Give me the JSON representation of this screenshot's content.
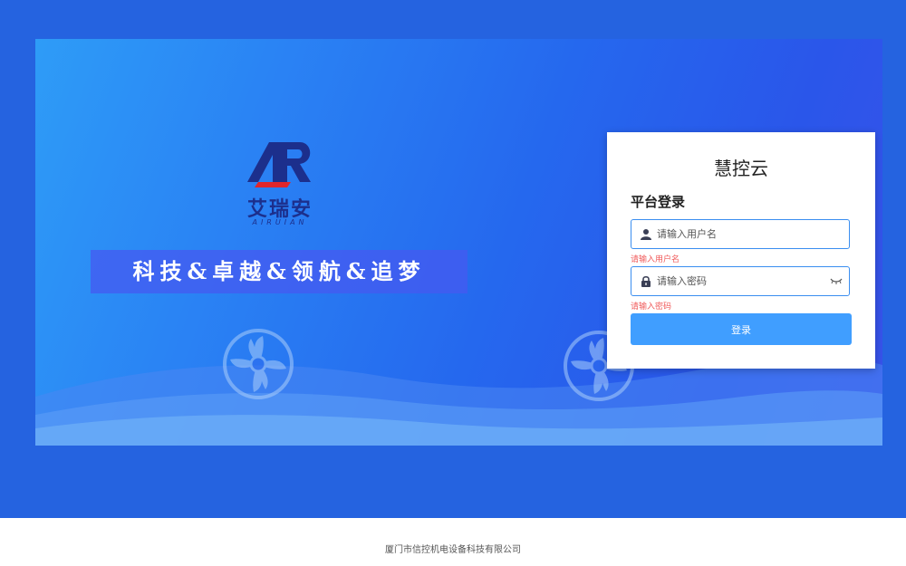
{
  "brand": {
    "logo_mark_text": "AR",
    "name_cn": "艾瑞安",
    "name_en": "AIRUIAN"
  },
  "slogan": "科技&卓越&领航&追梦",
  "login": {
    "title": "慧控云",
    "subtitle": "平台登录",
    "username": {
      "placeholder": "请输入用户名",
      "value": "",
      "error": "请输入用户名"
    },
    "password": {
      "placeholder": "请输入密码",
      "value": "",
      "error": "请输入密码"
    },
    "submit_label": "登录"
  },
  "footer": {
    "company": "厦门市信控机电设备科技有限公司"
  },
  "icons": {
    "username": "user-icon",
    "password": "lock-icon",
    "toggle": "eye-closed-icon",
    "decor": "fan-icon"
  },
  "colors": {
    "page_band": "#2563e0",
    "primary_button": "#409eff",
    "input_border": "#3a8ef0",
    "error_text": "#f05a5a",
    "brand_navy": "#1c2f8c",
    "brand_red": "#e0262b"
  }
}
